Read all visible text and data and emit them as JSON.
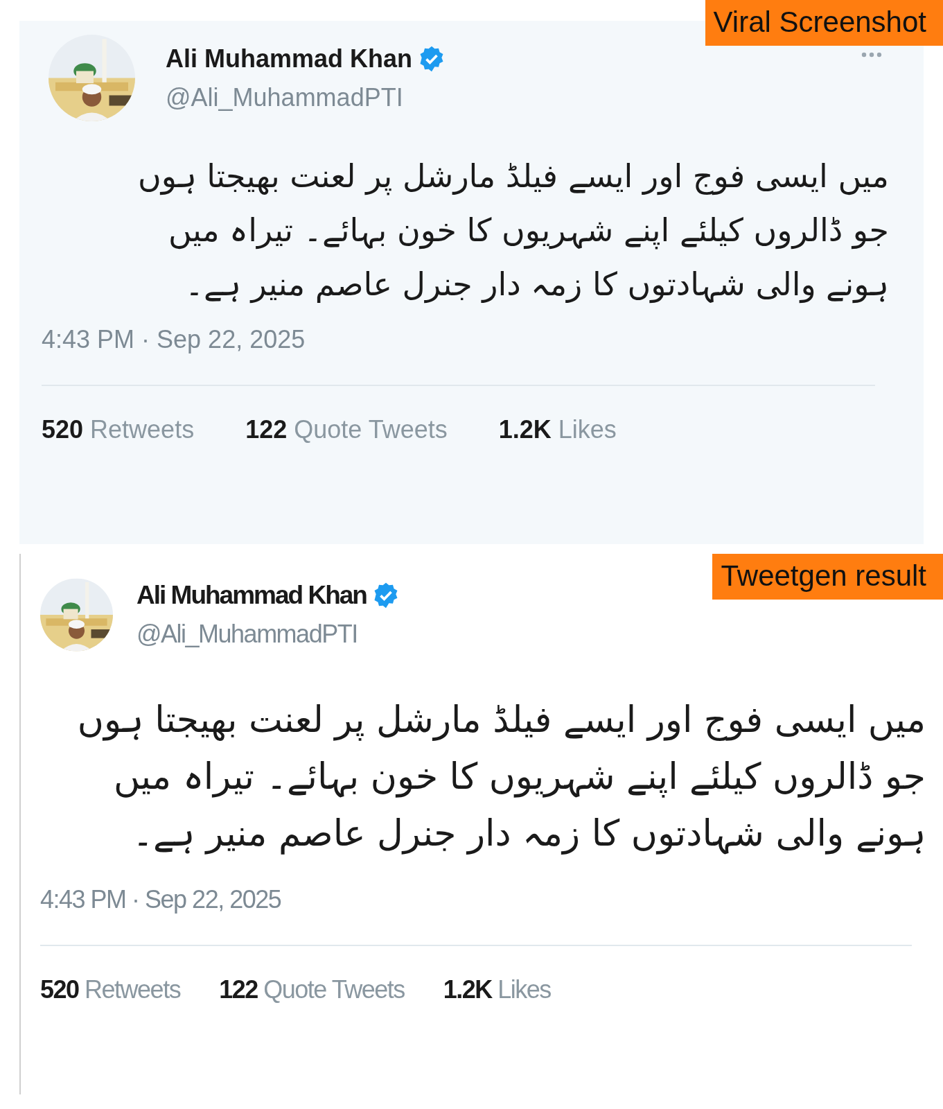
{
  "panels": [
    {
      "kind": "viral",
      "label": "Viral Screenshot",
      "tweet": {
        "name": "Ali Muhammad Khan",
        "verified": true,
        "handle": "@Ali_MuhammadPTI",
        "more_menu": true,
        "text": "میں ایسی فوج اور ایسے فیلڈ مارشل پر لعنت بھیجتا ہوں جو ڈالروں کیلئے اپنے شہریوں کا خون بہائے۔ تیراہ میں ہونے والی شہادتوں کا زمہ دار جنرل عاصم منیر ہے۔",
        "time": "4:43 PM · Sep 22, 2025",
        "stats": [
          {
            "count": "520",
            "label": "Retweets"
          },
          {
            "count": "122",
            "label": "Quote Tweets"
          },
          {
            "count": "1.2K",
            "label": "Likes"
          }
        ]
      }
    },
    {
      "kind": "generated",
      "label": "Tweetgen result",
      "tweet": {
        "name": "Ali Muhammad Khan",
        "verified": true,
        "handle": "@Ali_MuhammadPTI",
        "text": "میں ایسی فوج اور ایسے فیلڈ مارشل پر لعنت بھیجتا ہوں جو ڈالروں کیلئے اپنے شہریوں کا خون بہائے۔ تیراہ میں ہونے والی شہادتوں کا زمہ دار جنرل عاصم منیر ہے۔",
        "time": "4:43 PM · Sep 22, 2025",
        "stats": [
          {
            "count": "520",
            "label": "Retweets"
          },
          {
            "count": "122",
            "label": "Quote Tweets"
          },
          {
            "count": "1.2K",
            "label": "Likes"
          }
        ]
      }
    }
  ]
}
